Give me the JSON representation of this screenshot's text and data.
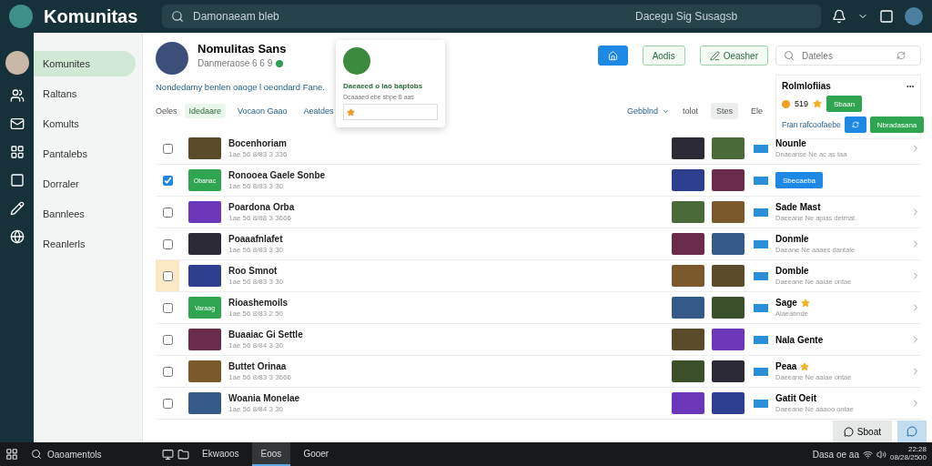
{
  "topbar": {
    "app_title": "Komunitas",
    "search_placeholder": "Damonaeam bleb",
    "center_text": "Dacegu Sig Susagsb"
  },
  "nav": [
    {
      "label": "Komunites",
      "selected": true
    },
    {
      "label": "Raltans",
      "selected": false
    },
    {
      "label": "Komults",
      "selected": false
    },
    {
      "label": "Pantalebs",
      "selected": false
    },
    {
      "label": "Dorraler",
      "selected": false
    },
    {
      "label": "Bannlees",
      "selected": false
    },
    {
      "label": "Reanlerls",
      "selected": false
    }
  ],
  "profile": {
    "name": "Nomulitas Sans",
    "handle": "Danmeraose 6 6 9",
    "verified": true,
    "description": "Nondedamy benlen oaoge l oeondard Fane."
  },
  "popup": {
    "title": "Daeaeed o lao baptobs",
    "subtitle": "Dcaaaed ebe sbpe 8 aas"
  },
  "actions": {
    "button_1": "Aodis",
    "button_2": "Oeasher",
    "search_placeholder": "Dateles"
  },
  "filters": {
    "label": "Oeles",
    "chips": [
      {
        "label": "Idedaare",
        "selected": true
      },
      {
        "label": "Vocaon Gaao",
        "selected": false
      },
      {
        "label": "Aeatdes",
        "selected": false
      }
    ]
  },
  "sort": {
    "label": "Gebblnd",
    "tabs": [
      {
        "label": "tolot",
        "selected": false
      },
      {
        "label": "Stes",
        "selected": true
      },
      {
        "label": "Ele",
        "selected": false
      }
    ]
  },
  "card": {
    "title": "Rolmlofiias",
    "count": "519",
    "button": "Sbaan",
    "link": "Fran rafcoofaebe",
    "action": "Nbradasana"
  },
  "rows": [
    {
      "title": "Bocenhoriam",
      "meta": "1ae 56  8/83  3 336",
      "checked": false,
      "highlighted": false,
      "thumb": {
        "kind": "photo"
      },
      "side": {
        "kind": "text",
        "title": "Nounle",
        "subtitle": "Dnaeanse Ne ac as taa",
        "star": false
      }
    },
    {
      "title": "Ronooea Gaele Sonbe",
      "meta": "1ae 56  8/83  3 30",
      "checked": true,
      "highlighted": false,
      "thumb": {
        "kind": "label",
        "text": "Obanac"
      },
      "side": {
        "kind": "button",
        "title": "Sbecaeba"
      }
    },
    {
      "title": "Poardona Orba",
      "meta": "1ae 56  8/88  3 3666",
      "checked": false,
      "highlighted": false,
      "thumb": {
        "kind": "photo"
      },
      "side": {
        "kind": "text",
        "title": "Sade Mast",
        "subtitle": "Daeeane Ne apias detmat.",
        "star": false
      }
    },
    {
      "title": "Poaaafnlafet",
      "meta": "1ae 56  8/83  3 30",
      "checked": false,
      "highlighted": false,
      "thumb": {
        "kind": "photo"
      },
      "side": {
        "kind": "text",
        "title": "Donmle",
        "subtitle": "Daeane Ne aaaes dantale",
        "star": false
      }
    },
    {
      "title": "Roo Smnot",
      "meta": "1ae 56  8/83  3 30",
      "checked": false,
      "highlighted": true,
      "thumb": {
        "kind": "photo"
      },
      "side": {
        "kind": "text",
        "title": "Domble",
        "subtitle": "Daeeane Ne aaiae ontae",
        "star": false
      }
    },
    {
      "title": "Rioashemoils",
      "meta": "1ae 56  8/83  2 50",
      "checked": false,
      "highlighted": false,
      "thumb": {
        "kind": "label",
        "text": "Varaag"
      },
      "side": {
        "kind": "text",
        "title": "Sage",
        "subtitle": "Alaeabnde",
        "star": true
      }
    },
    {
      "title": "Buaaiac Gi Settle",
      "meta": "1ae 56  8/84  3 30",
      "checked": false,
      "highlighted": false,
      "thumb": {
        "kind": "photo"
      },
      "side": {
        "kind": "text",
        "title": "Nala Gente",
        "star": false
      }
    },
    {
      "title": "Buttet Orinaa",
      "meta": "1ae 56  8/83  3 3666",
      "checked": false,
      "highlighted": false,
      "thumb": {
        "kind": "photo"
      },
      "side": {
        "kind": "text",
        "title": "Peaa",
        "subtitle": "Daeeane Ne aaiae ontae",
        "star": true
      }
    },
    {
      "title": "Woania Monelae",
      "meta": "1ae 56  8/84  3 30",
      "checked": false,
      "highlighted": false,
      "thumb": {
        "kind": "photo"
      },
      "side": {
        "kind": "text",
        "title": "Gatit Oeit",
        "subtitle": "Daeeane Ne aaaoo ontae",
        "star": false
      }
    }
  ],
  "float_button": "Sboat",
  "taskbar": {
    "search": "Oaoamentols",
    "apps": [
      {
        "label": "Ekwaoos",
        "selected": false
      },
      {
        "label": "Eoos",
        "selected": true
      },
      {
        "label": "Gooer",
        "selected": false
      }
    ],
    "tray": "Dasa oe aa",
    "time": "22:28",
    "date": "08/28/2500"
  }
}
